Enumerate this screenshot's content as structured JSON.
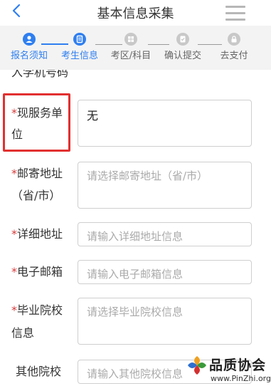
{
  "header": {
    "title": "基本信息采集",
    "back_icon": "chevron-left-icon",
    "menu_icon": "hamburger-menu-icon"
  },
  "steps": [
    {
      "label": "报名须知",
      "state": "done",
      "icon": "person-icon"
    },
    {
      "label": "考生信息",
      "state": "active",
      "icon": "document-icon"
    },
    {
      "label": "考区/科目",
      "state": "inactive",
      "icon": "grid-icon"
    },
    {
      "label": "确认提交",
      "state": "inactive",
      "icon": "check-document-icon"
    },
    {
      "label": "去支付",
      "state": "inactive",
      "icon": "lock-icon"
    }
  ],
  "form": {
    "cutoff_label": "入学机号码",
    "fields": [
      {
        "label_main": "现服务单",
        "label_cont": "位",
        "required": true,
        "value": "无",
        "placeholder": ""
      },
      {
        "label_main": "邮寄地址",
        "label_cont": "（省/市）",
        "required": true,
        "value": "",
        "placeholder": "请选择邮寄地址（省/市）"
      },
      {
        "label_main": "详细地址",
        "label_cont": "",
        "required": true,
        "value": "",
        "placeholder": "请输入详细地址信息"
      },
      {
        "label_main": "电子邮箱",
        "label_cont": "",
        "required": true,
        "value": "",
        "placeholder": "请输入电子邮箱信息"
      },
      {
        "label_main": "毕业院校",
        "label_cont": "信息",
        "required": true,
        "value": "",
        "placeholder": "请选择毕业院校信息"
      },
      {
        "label_main": "其他院校",
        "label_cont": "",
        "required": false,
        "value": "",
        "placeholder": "请输入其他院校信息"
      }
    ],
    "required_mark": "*"
  },
  "watermark": {
    "cn": "品质协会",
    "url": "www.PinZhi.org"
  },
  "colors": {
    "accent": "#2f7ff0",
    "required": "#d83a3a",
    "highlight": "#e23030"
  }
}
